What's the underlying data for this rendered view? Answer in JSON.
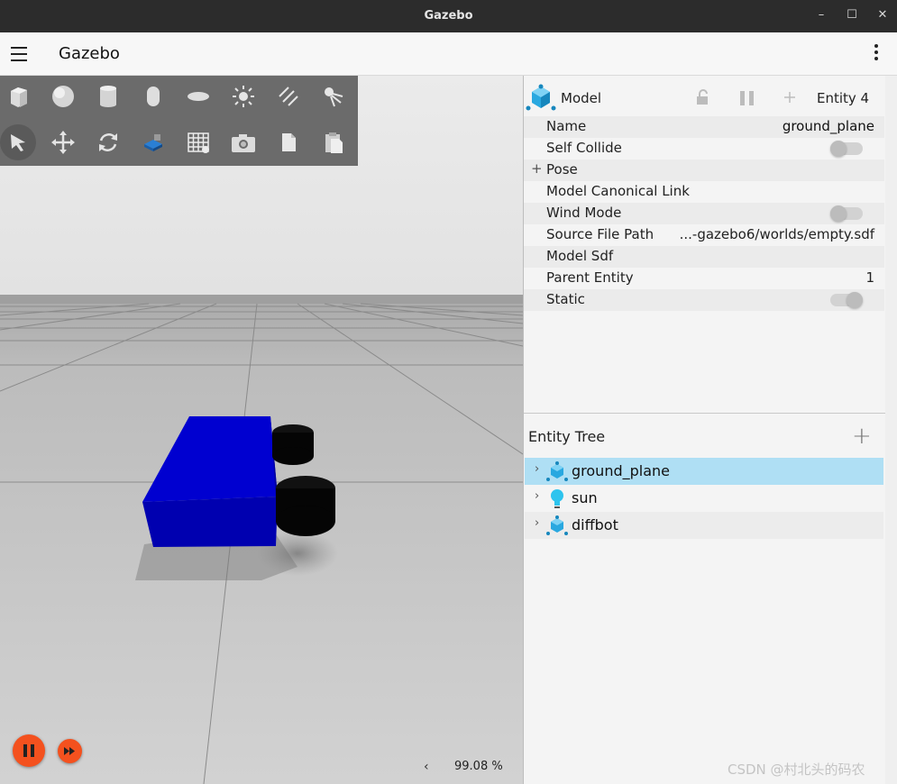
{
  "window": {
    "title": "Gazebo",
    "minimize": "–",
    "maximize": "☐",
    "close": "✕"
  },
  "app": {
    "title": "Gazebo"
  },
  "toolbar": {
    "row1": [
      "box-icon",
      "sphere-icon",
      "cylinder-icon",
      "capsule-icon",
      "ellipsoid-icon",
      "point-light-icon",
      "directional-light-icon",
      "spot-light-icon"
    ],
    "row2": [
      "select-arrow-icon",
      "translate-icon",
      "rotate-icon",
      "transform-control-icon",
      "grid-config-icon",
      "screenshot-icon",
      "copy-icon",
      "paste-icon"
    ]
  },
  "playback": {
    "speed": "99.08 %",
    "collapse_arrow": "‹"
  },
  "component_inspector": {
    "header_label": "Model",
    "entity_label": "Entity 4",
    "rows": [
      {
        "key": "Name",
        "value": "ground_plane"
      },
      {
        "key": "Self Collide",
        "toggle": false
      },
      {
        "key": "Pose",
        "expandable": true
      },
      {
        "key": "Model Canonical Link",
        "value": ""
      },
      {
        "key": "Wind Mode",
        "toggle": false
      },
      {
        "key": "Source File Path",
        "value": "...-gazebo6/worlds/empty.sdf"
      },
      {
        "key": "Model Sdf",
        "value": ""
      },
      {
        "key": "Parent Entity",
        "value": "1"
      },
      {
        "key": "Static",
        "toggle": true
      }
    ]
  },
  "entity_tree": {
    "header_label": "Entity Tree",
    "items": [
      {
        "name": "ground_plane",
        "icon": "model-icon",
        "selected": true
      },
      {
        "name": "sun",
        "icon": "light-bulb-icon",
        "selected": false
      },
      {
        "name": "diffbot",
        "icon": "model-icon",
        "selected": false
      }
    ]
  },
  "colors": {
    "accent": "#f4511e",
    "selection": "#afdff4",
    "robot_body": "#0000c8",
    "model_icon": "#29a8e0"
  },
  "watermark": "CSDN @村北头的码农"
}
